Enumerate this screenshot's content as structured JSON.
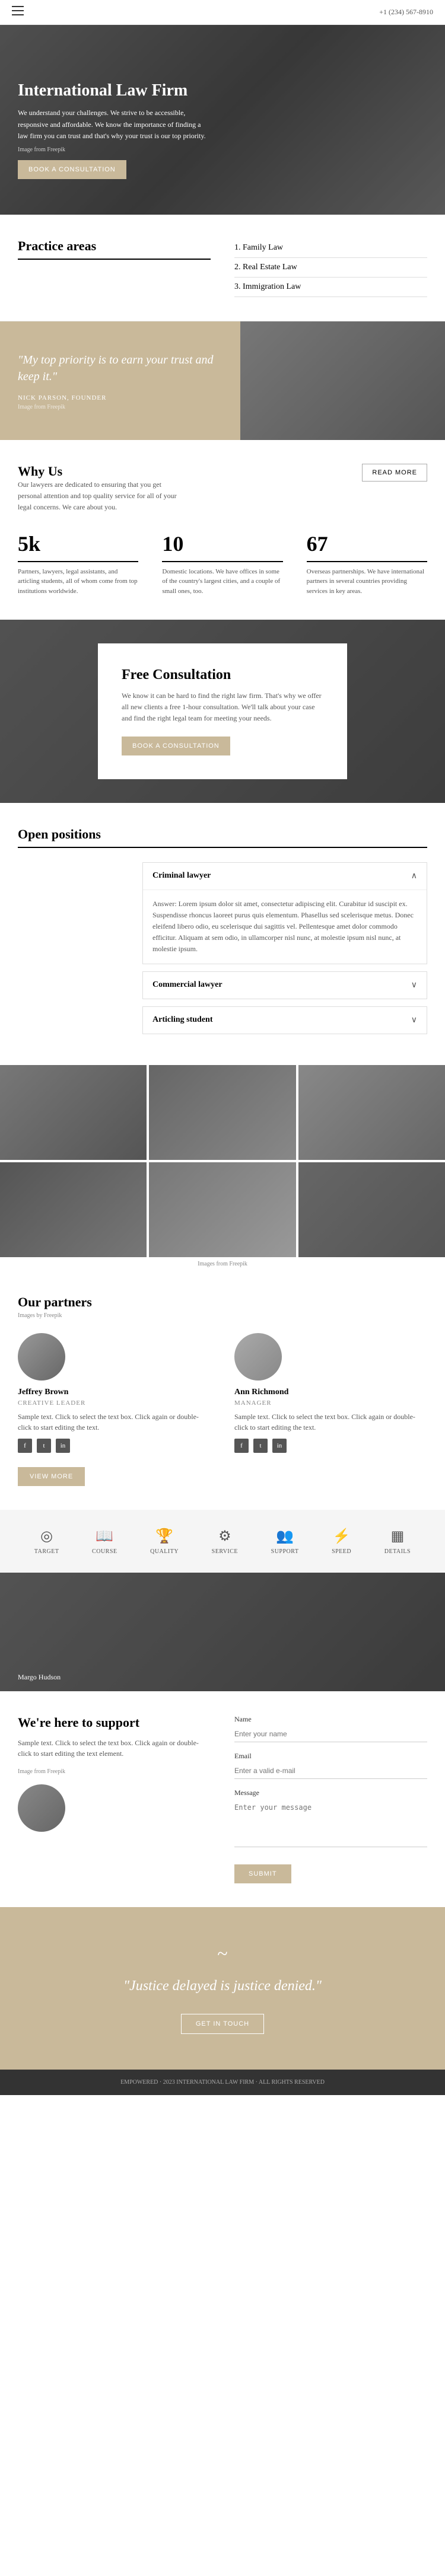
{
  "nav": {
    "menu_icon": "≡",
    "phone": "+1 (234) 567-8910"
  },
  "hero": {
    "title": "International Law Firm",
    "text": "We understand your challenges. We strive to be accessible, responsive and affordable. We know the importance of finding a law firm you can trust and that's why your trust is our top priority.",
    "img_credit": "Image from Freepik",
    "btn_label": "BOOK A CONSULTATION"
  },
  "practice": {
    "title": "Practice areas",
    "items": [
      {
        "number": "1.",
        "label": "Family Law"
      },
      {
        "number": "2.",
        "label": "Real Estate Law"
      },
      {
        "number": "3.",
        "label": "Immigration Law"
      }
    ]
  },
  "quote": {
    "text": "\"My top priority is to earn your trust and keep it.\"",
    "author": "NICK PARSON, FOUNDER",
    "img_credit": "Image from Freepik"
  },
  "why_us": {
    "title": "Why Us",
    "text": "Our lawyers are dedicated to ensuring that you get personal attention and top quality service for all of your legal concerns. We care about you.",
    "read_more_label": "READ MORE",
    "stats": [
      {
        "number": "5k",
        "description": "Partners, lawyers, legal assistants, and articling students, all of whom come from top institutions worldwide."
      },
      {
        "number": "10",
        "description": "Domestic locations. We have offices in some of the country's largest cities, and a couple of small ones, too."
      },
      {
        "number": "67",
        "description": "Overseas partnerships. We have international partners in several countries providing services in key areas."
      }
    ]
  },
  "free_consult": {
    "title": "Free Consultation",
    "text": "We know it can be hard to find the right law firm. That's why we offer all new clients a free 1-hour consultation. We'll talk about your case and find the right legal team for meeting your needs.",
    "btn_label": "BOOK A CONSULTATION"
  },
  "open_positions": {
    "section_title": "Open positions",
    "positions": [
      {
        "name": "Criminal lawyer",
        "expanded": true,
        "body": "Answer: Lorem ipsum dolor sit amet, consectetur adipiscing elit. Curabitur id suscipit ex. Suspendisse rhoncus laoreet purus quis elementum. Phasellus sed scelerisque metus. Donec eleifend libero odio, eu scelerisque dui sagittis vel. Pellentesque amet dolor commodo efficitur. Aliquam at sem odio, in ullamcorper nisl nunc, at molestie ipsum nisl nunc, at molestie ipsum."
      },
      {
        "name": "Commercial lawyer",
        "expanded": false,
        "body": ""
      },
      {
        "name": "Articling student",
        "expanded": false,
        "body": ""
      }
    ]
  },
  "gallery": {
    "img_credit": "Images from Freepik"
  },
  "partners": {
    "title": "Our partners",
    "credit": "Images by Freepik",
    "people": [
      {
        "name": "Jeffrey Brown",
        "role": "CREATIVE LEADER",
        "text": "Sample text. Click to select the text box. Click again or double-click to start editing the text.",
        "socials": [
          "f",
          "t",
          "in"
        ]
      },
      {
        "name": "Ann Richmond",
        "role": "MANAGER",
        "text": "Sample text. Click to select the text box. Click again or double-click to start editing the text.",
        "socials": [
          "f",
          "t",
          "in"
        ]
      }
    ],
    "view_more_label": "VIEW MORE"
  },
  "icons_row": {
    "items": [
      {
        "symbol": "☀",
        "label": "TARGET"
      },
      {
        "symbol": "📖",
        "label": "COURSE"
      },
      {
        "symbol": "🏆",
        "label": "QUALITY"
      },
      {
        "symbol": "⚙",
        "label": "SERVICE"
      },
      {
        "symbol": "👥",
        "label": "SUPPORT"
      },
      {
        "symbol": "⚡",
        "label": "SPEED"
      },
      {
        "symbol": "▦",
        "label": "DETAILS"
      }
    ]
  },
  "team": {
    "label": "Margo Hudson"
  },
  "support": {
    "title": "We're here to support",
    "text": "Sample text. Click to select the text box. Click again or double-click to start editing the text element.",
    "credit": "Image from Freepik",
    "form": {
      "name_label": "Name",
      "name_placeholder": "Enter your name",
      "email_label": "Email",
      "email_placeholder": "Enter a valid e-mail",
      "message_label": "Message",
      "message_placeholder": "Enter your message",
      "submit_label": "SUBMIT"
    }
  },
  "final": {
    "signature": "~",
    "quote": "\"Justice delayed is justice denied.\"",
    "btn_label": "GET IN TOUCH"
  },
  "footer": {
    "text": "EMPOWERED   ·   2023 INTERNATIONAL LAW FIRM   ·   ALL RIGHTS RESERVED"
  }
}
